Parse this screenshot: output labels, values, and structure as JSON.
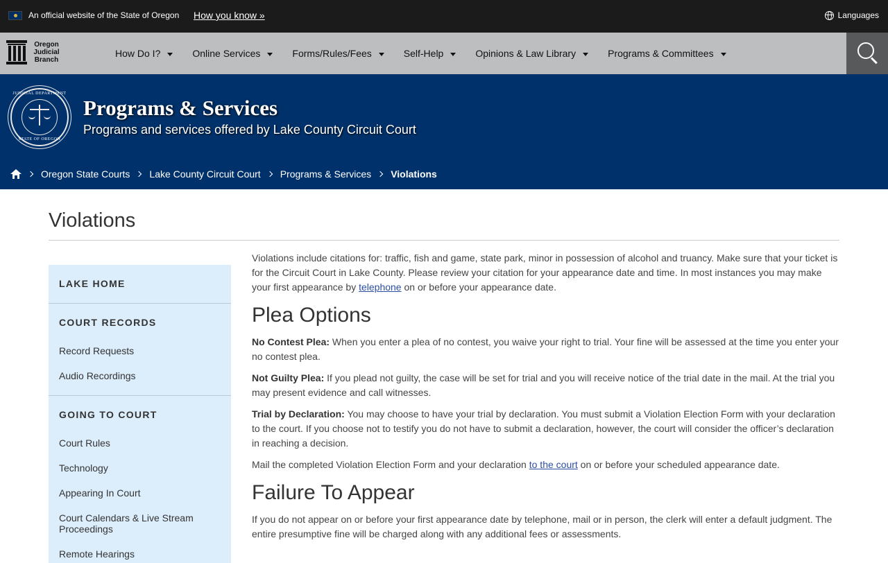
{
  "banner": {
    "official_text": "An official website of the State of Oregon",
    "how_you_know": "How you know »",
    "languages": "Languages"
  },
  "logo": {
    "line1": "Oregon",
    "line2": "Judicial",
    "line3": "Branch"
  },
  "nav": {
    "items": [
      {
        "label": "How Do I?"
      },
      {
        "label": "Online Services"
      },
      {
        "label": "Forms/Rules/Fees"
      },
      {
        "label": "Self-Help"
      },
      {
        "label": "Opinions & Law Library"
      },
      {
        "label": "Programs & Committees"
      }
    ]
  },
  "seal": {
    "top_text": "JUDICIAL DEPARTMENT",
    "bottom_text": "STATE OF OREGON"
  },
  "hero": {
    "title": "Programs & Services",
    "subtitle": "Programs and services offered by Lake County Circuit Court"
  },
  "breadcrumb": {
    "items": [
      "Oregon State Courts",
      "Lake County Circuit Court",
      "Programs & Services"
    ],
    "current": "Violations"
  },
  "page": {
    "title": "Violations"
  },
  "sidebar": {
    "lake_home": "LAKE HOME",
    "court_records": "COURT RECORDS",
    "record_requests": "Record Requests",
    "audio_recordings": "Audio Recordings",
    "going_to_court": "GOING TO COURT",
    "court_rules": "Court Rules",
    "technology": "Technology",
    "appearing_in_court": "Appearing In Court",
    "court_calendars": "Court Calendars & Live Stream Proceedings",
    "remote_hearings": "Remote Hearings"
  },
  "content": {
    "intro_before": "Violations include citations for: traffic, fish and game, state park, minor in possession of alcohol and truancy. Make sure that your ticket is for the Circuit Court in Lake County. Please review your citation for your appearance date and time. In most instances you may make your first appearance by ",
    "intro_link": "telephone",
    "intro_after": " on or before your appearance date.",
    "plea_heading": "Plea Options",
    "no_contest_label": "No Contest Plea:",
    "no_contest_text": " When you enter a plea of no contest, you waive your right to trial. Your fine will be assessed at the time you enter your no contest plea.",
    "not_guilty_label": "Not Guilty Plea:",
    "not_guilty_text": " If you plead not guilty, the case will be set for trial and you will receive notice of the trial date in the mail. At the trial you may present evidence and call witnesses.",
    "declaration_label": "Trial by Declaration:",
    "declaration_text": " You may choose to have your trial by declaration. You must submit a Violation Election Form with your declaration to the court. If you choose not to testify you do not have to submit a declaration, however, the court will consider the officer’s declaration in reaching a decision.",
    "mail_before": "Mail the completed Violation Election Form and your declaration ",
    "mail_link": "to the court",
    "mail_after": " on or before your scheduled appearance date.",
    "fta_heading": "Failure To Appear",
    "fta_text": "If you do not appear on or before your first appearance date by telephone, mail or in person, the clerk will enter a default judgment. The entire presumptive fine will be charged along with any additional fees or assessments."
  }
}
